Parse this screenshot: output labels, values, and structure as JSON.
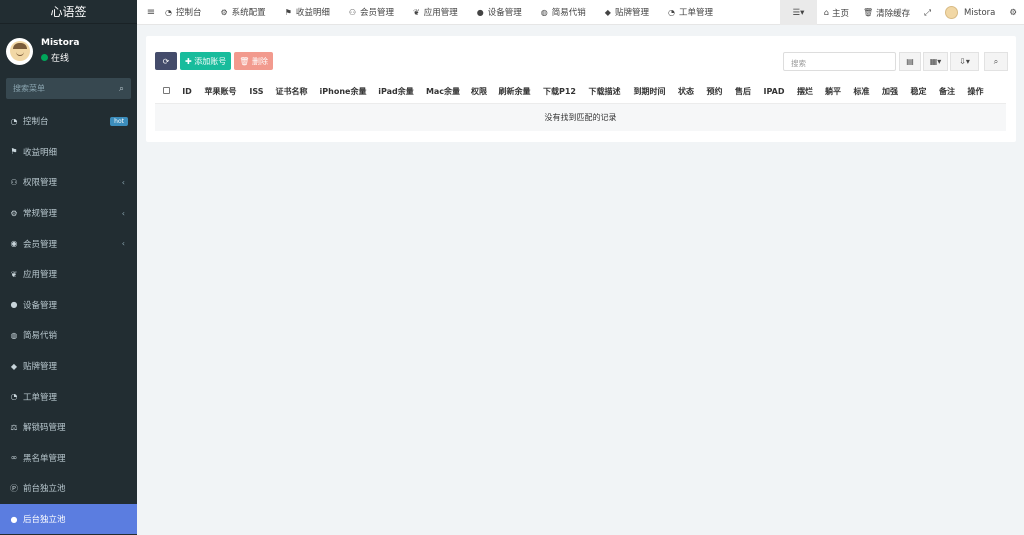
{
  "app": {
    "logo": "心语签"
  },
  "user": {
    "name": "Mistora",
    "status": "在线"
  },
  "sidebar": {
    "search_placeholder": "搜索菜单",
    "items": [
      {
        "label": "控制台",
        "icon": "dashboard-icon",
        "badge": "hot"
      },
      {
        "label": "收益明细",
        "icon": "flag-icon"
      },
      {
        "label": "权限管理",
        "icon": "group-icon",
        "arrow": "‹"
      },
      {
        "label": "常规管理",
        "icon": "cogs-icon",
        "arrow": "‹"
      },
      {
        "label": "会员管理",
        "icon": "user-circle-icon",
        "arrow": "‹"
      },
      {
        "label": "应用管理",
        "icon": "leaf-icon"
      },
      {
        "label": "设备管理",
        "icon": "circle-icon"
      },
      {
        "label": "简易代销",
        "icon": "globe-icon"
      },
      {
        "label": "贴牌管理",
        "icon": "tags-icon"
      },
      {
        "label": "工单管理",
        "icon": "dashboard-icon"
      },
      {
        "label": "解锁码管理",
        "icon": "balance-scale-icon"
      },
      {
        "label": "黑名单管理",
        "icon": "bicycle-icon"
      },
      {
        "label": "前台独立池",
        "icon": "product-hunt-icon"
      },
      {
        "label": "后台独立池",
        "icon": "apple-icon",
        "active": true
      }
    ]
  },
  "topbar": {
    "toggle": "≡",
    "nav": [
      {
        "label": "控制台",
        "icon": "dashboard-icon"
      },
      {
        "label": "系统配置",
        "icon": "gear-icon"
      },
      {
        "label": "收益明细",
        "icon": "flag-icon"
      },
      {
        "label": "会员管理",
        "icon": "group-icon"
      },
      {
        "label": "应用管理",
        "icon": "leaf-icon"
      },
      {
        "label": "设备管理",
        "icon": "circle-icon"
      },
      {
        "label": "简易代销",
        "icon": "globe-icon"
      },
      {
        "label": "贴牌管理",
        "icon": "tags-icon"
      },
      {
        "label": "工单管理",
        "icon": "dashboard-icon"
      }
    ],
    "right": {
      "home": "主页",
      "clear_cache": "清除缓存",
      "user": "Mistora"
    }
  },
  "toolbar": {
    "add": "添加账号",
    "delete": "删除",
    "search_placeholder": "搜索"
  },
  "table": {
    "columns": [
      "ID",
      "苹果账号",
      "ISS",
      "证书名称",
      "iPhone余量",
      "iPad余量",
      "Mac余量",
      "权限",
      "刷新余量",
      "下载P12",
      "下载描述",
      "到期时间",
      "状态",
      "预约",
      "售后",
      "IPAD",
      "摆烂",
      "躺平",
      "标准",
      "加强",
      "稳定",
      "备注",
      "操作"
    ],
    "empty_text": "没有找到匹配的记录"
  }
}
